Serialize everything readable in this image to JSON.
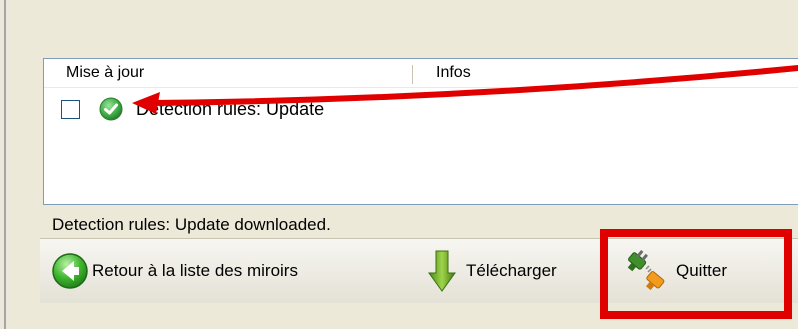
{
  "top_caption": "                , ...",
  "list": {
    "columns": [
      "Mise à jour",
      "Infos"
    ],
    "rows": [
      {
        "label": "Detection rules: Update",
        "checked": false,
        "status_icon": "check-circle-icon"
      }
    ]
  },
  "status_text": "Detection rules: Update downloaded.",
  "toolbar": {
    "back_label": "Retour à la liste des miroirs",
    "download_label": "Télécharger",
    "quit_label": "Quitter"
  },
  "colors": {
    "highlight": "#e00000",
    "accent_green": "#4caf50"
  }
}
